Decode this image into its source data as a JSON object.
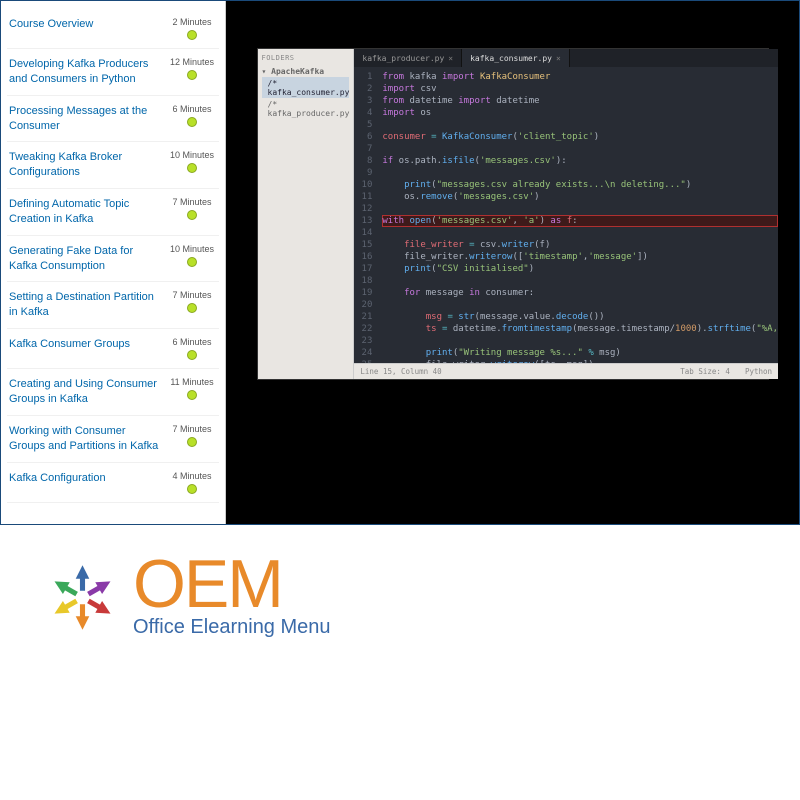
{
  "sidebar": {
    "items": [
      {
        "title": "Course Overview",
        "duration": "2 Minutes"
      },
      {
        "title": "Developing Kafka Producers and Consumers in Python",
        "duration": "12 Minutes"
      },
      {
        "title": "Processing Messages at the Consumer",
        "duration": "6 Minutes"
      },
      {
        "title": "Tweaking Kafka Broker Configurations",
        "duration": "10 Minutes"
      },
      {
        "title": "Defining Automatic Topic Creation in Kafka",
        "duration": "7 Minutes"
      },
      {
        "title": "Generating Fake Data for Kafka Consumption",
        "duration": "10 Minutes"
      },
      {
        "title": "Setting a Destination Partition in Kafka",
        "duration": "7 Minutes"
      },
      {
        "title": "Kafka Consumer Groups",
        "duration": "6 Minutes"
      },
      {
        "title": "Creating and Using Consumer Groups in Kafka",
        "duration": "11 Minutes"
      },
      {
        "title": "Working with Consumer Groups and Partitions in Kafka",
        "duration": "7 Minutes"
      },
      {
        "title": "Kafka Configuration",
        "duration": "4 Minutes"
      }
    ]
  },
  "editor": {
    "folders_header": "FOLDERS",
    "root_folder": "ApacheKafka",
    "files": [
      {
        "name": "kafka_consumer.py",
        "selected": true
      },
      {
        "name": "kafka_producer.py",
        "selected": false
      }
    ],
    "tabs": [
      {
        "label": "kafka_producer.py",
        "active": false
      },
      {
        "label": "kafka_consumer.py",
        "active": true
      }
    ],
    "status_left": "Line 15, Column 40",
    "status_mid": "Tab Size: 4",
    "status_right": "Python"
  },
  "logo": {
    "oem": "OEM",
    "sub": "Office Elearning Menu"
  }
}
